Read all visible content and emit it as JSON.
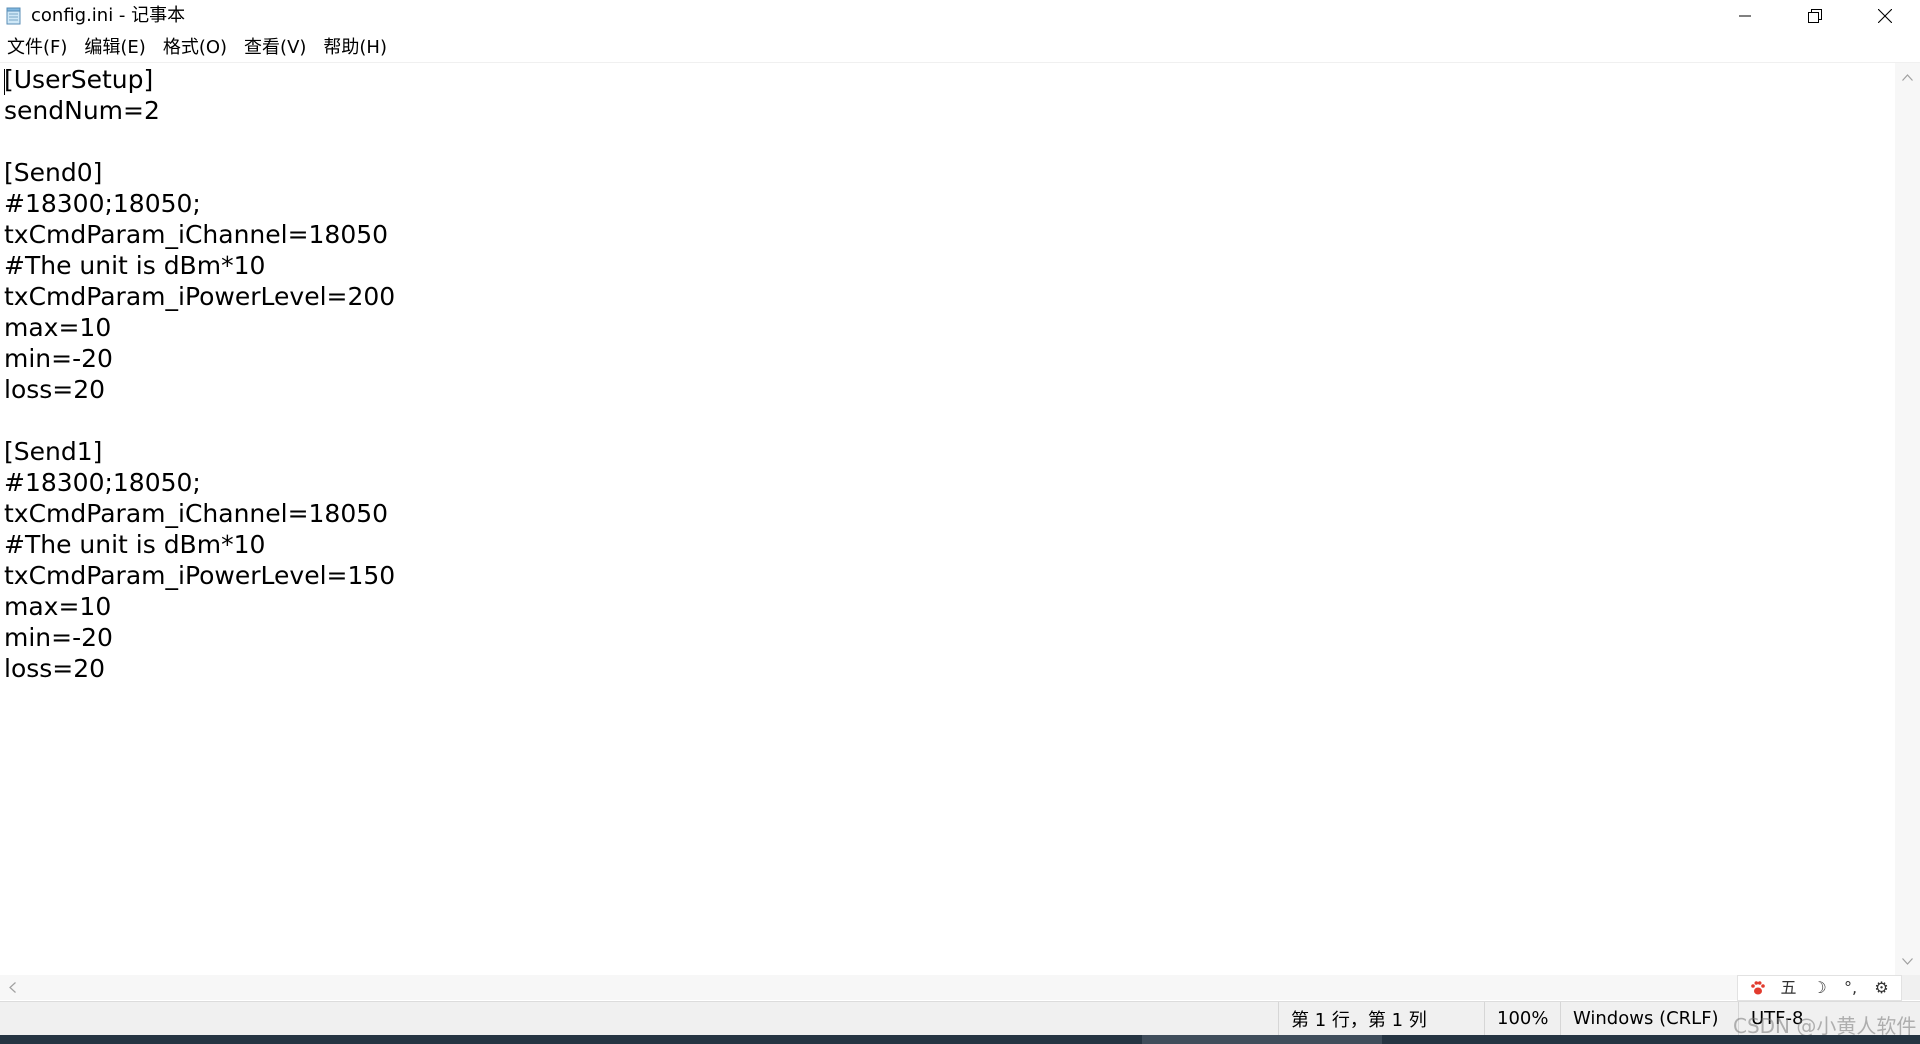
{
  "window": {
    "title": "config.ini - 记事本"
  },
  "menu": [
    {
      "label": "文件(F)"
    },
    {
      "label": "编辑(E)"
    },
    {
      "label": "格式(O)"
    },
    {
      "label": "查看(V)"
    },
    {
      "label": "帮助(H)"
    }
  ],
  "editor": {
    "content": "[UserSetup]\nsendNum=2\n\n[Send0]\n#18300;18050;\ntxCmdParam_iChannel=18050\n#The unit is dBm*10\ntxCmdParam_iPowerLevel=200\nmax=10\nmin=-20\nloss=20\n\n[Send1]\n#18300;18050;\ntxCmdParam_iChannel=18050\n#The unit is dBm*10\ntxCmdParam_iPowerLevel=150\nmax=10\nmin=-20\nloss=20"
  },
  "ime": {
    "items": [
      {
        "icon": "paw-icon",
        "glyph": "🐾"
      },
      {
        "icon": "wubi-mode-icon",
        "glyph": "五"
      },
      {
        "icon": "moon-icon",
        "glyph": "☽"
      },
      {
        "icon": "punctuation-icon",
        "glyph": "°,"
      },
      {
        "icon": "gear-icon",
        "glyph": "⚙"
      }
    ]
  },
  "status": {
    "position": "第 1 行，第 1 列",
    "zoom": "100%",
    "line_ending": "Windows (CRLF)",
    "encoding": "UTF-8"
  },
  "watermark": "CSDN @小黄人软件",
  "colors": {
    "statusbar_bg": "#f0f0f0",
    "taskbar_bg": "#253442",
    "scrollbar_bg": "#f7f7f7"
  }
}
